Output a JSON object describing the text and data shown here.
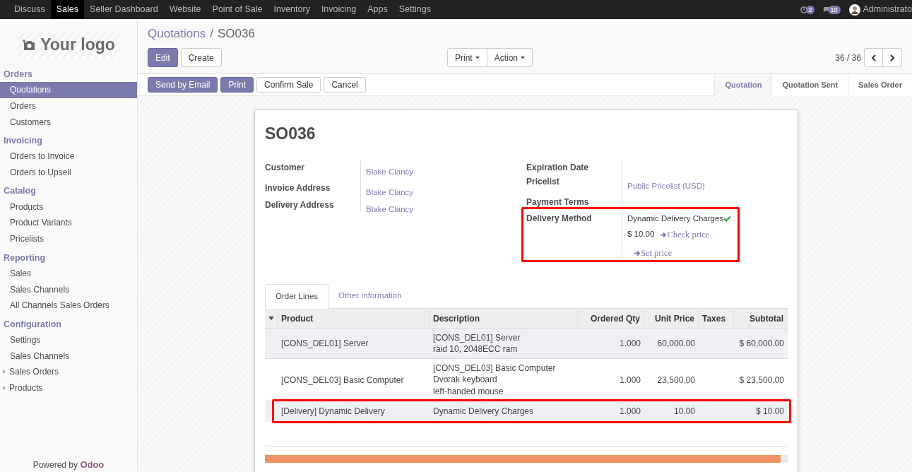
{
  "top_menu": [
    {
      "label": "Discuss",
      "selected": false
    },
    {
      "label": "Sales",
      "selected": true
    },
    {
      "label": "Seller Dashboard",
      "selected": false
    },
    {
      "label": "Website",
      "selected": false
    },
    {
      "label": "Point of Sale",
      "selected": false
    },
    {
      "label": "Inventory",
      "selected": false
    },
    {
      "label": "Invoicing",
      "selected": false
    },
    {
      "label": "Apps",
      "selected": false
    },
    {
      "label": "Settings",
      "selected": false
    }
  ],
  "systray": {
    "activity_count": "2",
    "message_count": "10",
    "user": "Administrato"
  },
  "sidebar": {
    "logo_text": "Your logo",
    "sections": [
      {
        "title": "Orders",
        "items": [
          {
            "label": "Quotations",
            "selected": true,
            "kind": "link"
          },
          {
            "label": "Orders",
            "selected": false,
            "kind": "link"
          },
          {
            "label": "Customers",
            "selected": false,
            "kind": "link"
          }
        ]
      },
      {
        "title": "Invoicing",
        "items": [
          {
            "label": "Orders to Invoice",
            "selected": false,
            "kind": "link"
          },
          {
            "label": "Orders to Upsell",
            "selected": false,
            "kind": "link"
          }
        ]
      },
      {
        "title": "Catalog",
        "items": [
          {
            "label": "Products",
            "selected": false,
            "kind": "link"
          },
          {
            "label": "Product Variants",
            "selected": false,
            "kind": "link"
          },
          {
            "label": "Pricelists",
            "selected": false,
            "kind": "link"
          }
        ]
      },
      {
        "title": "Reporting",
        "items": [
          {
            "label": "Sales",
            "selected": false,
            "kind": "link"
          },
          {
            "label": "Sales Channels",
            "selected": false,
            "kind": "link"
          },
          {
            "label": "All Channels Sales Orders",
            "selected": false,
            "kind": "link"
          }
        ]
      },
      {
        "title": "Configuration",
        "items": [
          {
            "label": "Settings",
            "selected": false,
            "kind": "link"
          },
          {
            "label": "Sales Channels",
            "selected": false,
            "kind": "link"
          },
          {
            "label": "Sales Orders",
            "selected": false,
            "kind": "folder"
          },
          {
            "label": "Products",
            "selected": false,
            "kind": "folder"
          }
        ]
      }
    ],
    "footer": "Powered by **Odoo**"
  },
  "breadcrumb_separator": "/",
  "breadcrumb": [
    {
      "label": "Quotations",
      "kind": "link"
    },
    {
      "label": "SO036",
      "kind": "current"
    }
  ],
  "control_buttons": [
    {
      "label": "Edit",
      "kind": "primary"
    },
    {
      "label": "Create",
      "kind": "default"
    }
  ],
  "dropdowns": [
    "Print",
    "Action"
  ],
  "pager": "36 / 36",
  "action_buttons": [
    {
      "label": "Send by Email",
      "kind": "primary"
    },
    {
      "label": "Print",
      "kind": "primary"
    },
    {
      "label": "Confirm Sale",
      "kind": "default"
    },
    {
      "label": "Cancel",
      "kind": "default"
    }
  ],
  "status_steps": [
    {
      "label": "Quotation",
      "selected": true
    },
    {
      "label": "Quotation Sent",
      "selected": false
    },
    {
      "label": "Sales Order",
      "selected": false
    }
  ],
  "form": {
    "title": "SO036",
    "left_fields": [
      {
        "label": "Customer",
        "value": "Blake Clancy"
      },
      {
        "label": "Invoice Address",
        "value": "Blake Clancy"
      },
      {
        "label": "Delivery Address",
        "value": "Blake Clancy"
      }
    ],
    "right_fields": [
      {
        "label": "Expiration Date"
      },
      {
        "label": "Pricelist",
        "value": "Public Pricelist (USD)"
      },
      {
        "label": "Payment Terms"
      }
    ],
    "delivery": {
      "label": "Delivery Method",
      "value": "Dynamic Delivery Charges",
      "verified": true,
      "price": "$ 10.00",
      "links": [
        "Check price",
        "Set price"
      ],
      "highlighted": true
    }
  },
  "tabs": [
    {
      "label": "Order Lines",
      "selected": true
    },
    {
      "label": "Other Information",
      "selected": false
    }
  ],
  "table": {
    "columns": [
      {
        "label": "Product",
        "kind": "text"
      },
      {
        "label": "Description",
        "kind": "text"
      },
      {
        "label": "Ordered Qty",
        "kind": "number"
      },
      {
        "label": "Unit Price",
        "kind": "number"
      },
      {
        "label": "Taxes",
        "kind": "text"
      },
      {
        "label": "Subtotal",
        "kind": "number"
      }
    ],
    "rows": [
      {
        "product": "[CONS_DEL01] Server",
        "description": [
          "[CONS_DEL01] Server",
          "raid 10, 2048ECC ram"
        ],
        "qty": "1.000",
        "unit_price": "60,000.00",
        "subtotal": "$ 60,000.00",
        "highlighted": false
      },
      {
        "product": "[CONS_DEL03] Basic Computer",
        "description": [
          "[CONS_DEL03] Basic Computer",
          "Dvorak keyboard",
          "left-handed mouse"
        ],
        "qty": "1.000",
        "unit_price": "23,500.00",
        "subtotal": "$ 23,500.00",
        "highlighted": false
      },
      {
        "product": "[Delivery] Dynamic Delivery",
        "description": [
          "Dynamic Delivery Charges"
        ],
        "qty": "1.000",
        "unit_price": "10.00",
        "subtotal": "$ 10.00",
        "highlighted": true
      }
    ]
  }
}
